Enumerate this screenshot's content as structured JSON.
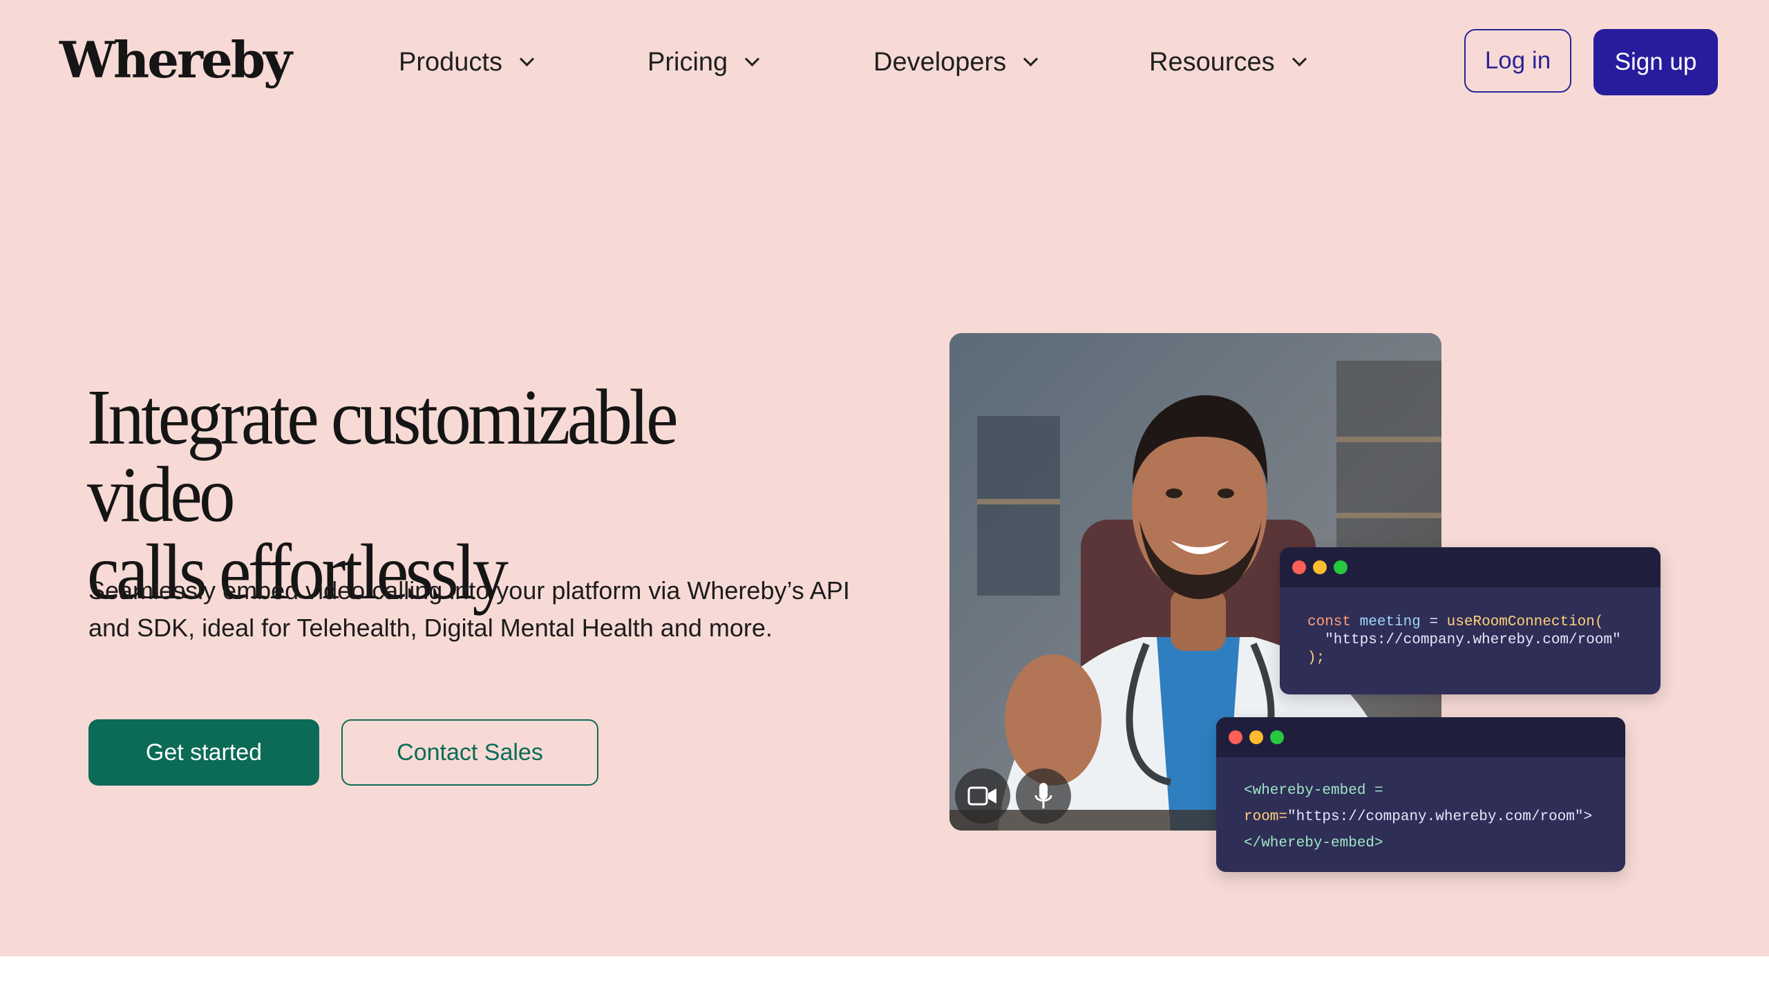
{
  "header": {
    "logo": "Whereby",
    "nav": [
      {
        "label": "Products"
      },
      {
        "label": "Pricing"
      },
      {
        "label": "Developers"
      },
      {
        "label": "Resources"
      }
    ],
    "login_label": "Log in",
    "signup_label": "Sign up"
  },
  "hero": {
    "headline_line1": "Integrate customizable video",
    "headline_line2": "calls effortlessly",
    "subtext": "Seamlessly embed video calling into your platform via Whereby’s API and SDK, ideal for Telehealth, Digital Mental Health and more.",
    "primary_cta": "Get started",
    "secondary_cta": "Contact Sales"
  },
  "video": {
    "camera_icon": "video-camera-icon",
    "mic_icon": "microphone-icon"
  },
  "code_card_1": {
    "kw": "const",
    "var": "meeting",
    "op": " = ",
    "fn": "useRoomConnection(",
    "line2": "  \"https://company.whereby.com/room\"",
    "line3": ");"
  },
  "code_card_2": {
    "line1": "<whereby-embed =",
    "line2_attr": "room=",
    "line2_str": "\"https://company.whereby.com/room\">",
    "line3": "</whereby-embed>"
  },
  "colors": {
    "background": "#f7dad5",
    "brand_purple": "#271c9c",
    "brand_green": "#0b6b56",
    "code_bg": "#2f2e56"
  }
}
